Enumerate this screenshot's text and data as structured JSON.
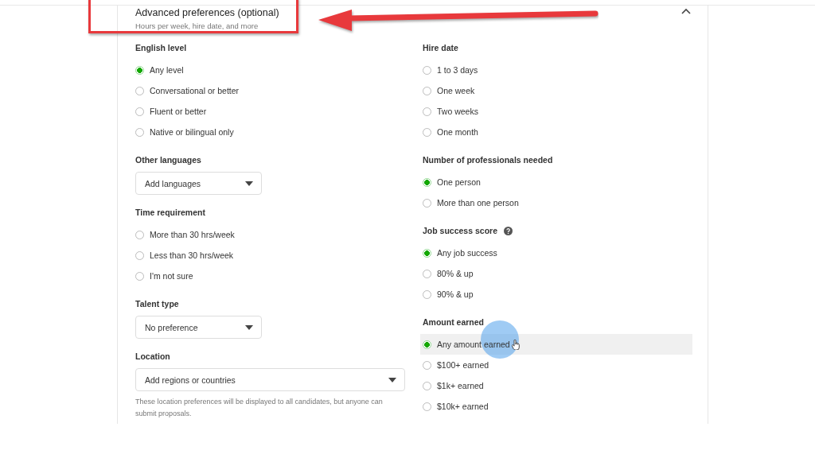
{
  "header": {
    "title": "Advanced preferences (optional)",
    "subtitle": "Hours per week, hire date, and more",
    "expanded": true
  },
  "columns": [
    [
      {
        "kind": "radio",
        "label": "English level",
        "options": [
          {
            "label": "Any level",
            "selected": true,
            "hovered": false
          },
          {
            "label": "Conversational or better",
            "selected": false,
            "hovered": false
          },
          {
            "label": "Fluent or better",
            "selected": false,
            "hovered": false
          },
          {
            "label": "Native or bilingual only",
            "selected": false,
            "hovered": false
          }
        ]
      },
      {
        "kind": "select",
        "label": "Other languages",
        "value": "Add languages"
      },
      {
        "kind": "radio",
        "label": "Time requirement",
        "options": [
          {
            "label": "More than 30 hrs/week",
            "selected": false,
            "hovered": false
          },
          {
            "label": "Less than 30 hrs/week",
            "selected": false,
            "hovered": false
          },
          {
            "label": "I'm not sure",
            "selected": false,
            "hovered": false
          }
        ]
      },
      {
        "kind": "select",
        "label": "Talent type",
        "value": "No preference"
      },
      {
        "kind": "select",
        "label": "Location",
        "value": "Add regions or countries",
        "note": "These location preferences will be displayed to all candidates, but anyone can submit proposals."
      }
    ],
    [
      {
        "kind": "radio",
        "label": "Hire date",
        "options": [
          {
            "label": "1 to 3 days",
            "selected": false,
            "hovered": false
          },
          {
            "label": "One week",
            "selected": false,
            "hovered": false
          },
          {
            "label": "Two weeks",
            "selected": false,
            "hovered": false
          },
          {
            "label": "One month",
            "selected": false,
            "hovered": false
          }
        ]
      },
      {
        "kind": "radio",
        "label": "Number of professionals needed",
        "options": [
          {
            "label": "One person",
            "selected": true,
            "hovered": false
          },
          {
            "label": "More than one person",
            "selected": false,
            "hovered": false
          }
        ]
      },
      {
        "kind": "radio",
        "label": "Job success score",
        "help": true,
        "options": [
          {
            "label": "Any job success",
            "selected": true,
            "hovered": false
          },
          {
            "label": "80% & up",
            "selected": false,
            "hovered": false
          },
          {
            "label": "90% & up",
            "selected": false,
            "hovered": false
          }
        ]
      },
      {
        "kind": "radio",
        "label": "Amount earned",
        "options": [
          {
            "label": "Any amount earned",
            "selected": true,
            "hovered": true
          },
          {
            "label": "$100+ earned",
            "selected": false,
            "hovered": false
          },
          {
            "label": "$1k+ earned",
            "selected": false,
            "hovered": false
          },
          {
            "label": "$10k+ earned",
            "selected": false,
            "hovered": false
          }
        ]
      }
    ]
  ]
}
